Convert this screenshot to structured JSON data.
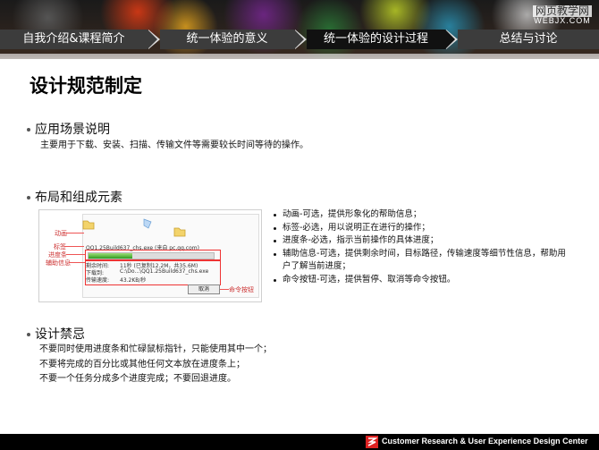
{
  "watermark": {
    "line1": "网页教学网",
    "line2": "WEBJX.COM"
  },
  "nav": {
    "tabs": [
      {
        "label": "自我介绍&课程简介"
      },
      {
        "label": "统一体验的意义"
      },
      {
        "label": "统一体验的设计过程"
      },
      {
        "label": "总结与讨论"
      }
    ]
  },
  "page": {
    "title": "设计规范制定"
  },
  "section1": {
    "heading": "应用场景说明",
    "text": "主要用于下载、安装、扫描、传输文件等需要较长时间等待的操作。"
  },
  "section2": {
    "heading": "布局和组成元素",
    "screenshot": {
      "labels": {
        "anim": "动画",
        "tag": "标签",
        "progress": "进度条",
        "info": "辅助信息",
        "cmd": "命令按钮"
      },
      "filename": "QQ1.25Build637_chs.exe (来自 pc.qq.com)",
      "remain_label": "剩余时间:",
      "remain_value": "11秒 (已复制12.2M，共35.6M)",
      "dl_label": "下载到:",
      "dl_value": "C:\\Do...\\QQ1.25Build637_chs.exe",
      "rate_label": "传输速度:",
      "rate_value": "43.2KB/秒",
      "cancel": "取消",
      "progress_fraction": 0.35
    },
    "notes": [
      {
        "text": "动画-可选，提供形象化的帮助信息；"
      },
      {
        "text": "标签-必选，用以说明正在进行的操作；"
      },
      {
        "text": "进度条-必选，指示当前操作的具体进度；"
      },
      {
        "text": "辅助信息-可选，提供剩余时间，目标路径，传输速度等细节性信息，帮助用户了解当前进度；"
      },
      {
        "text": "命令按钮-可选，提供暂停、取消等命令按钮。"
      }
    ]
  },
  "section3": {
    "heading": "设计禁忌",
    "lines": [
      "不要同时使用进度条和忙碌鼠标指针，只能使用其中一个；",
      "不要将完成的百分比或其他任何文本放在进度条上；",
      "不要一个任务分成多个进度完成；不要回退进度。"
    ]
  },
  "footer": {
    "text": "Customer Research & User Experience Design Center"
  }
}
